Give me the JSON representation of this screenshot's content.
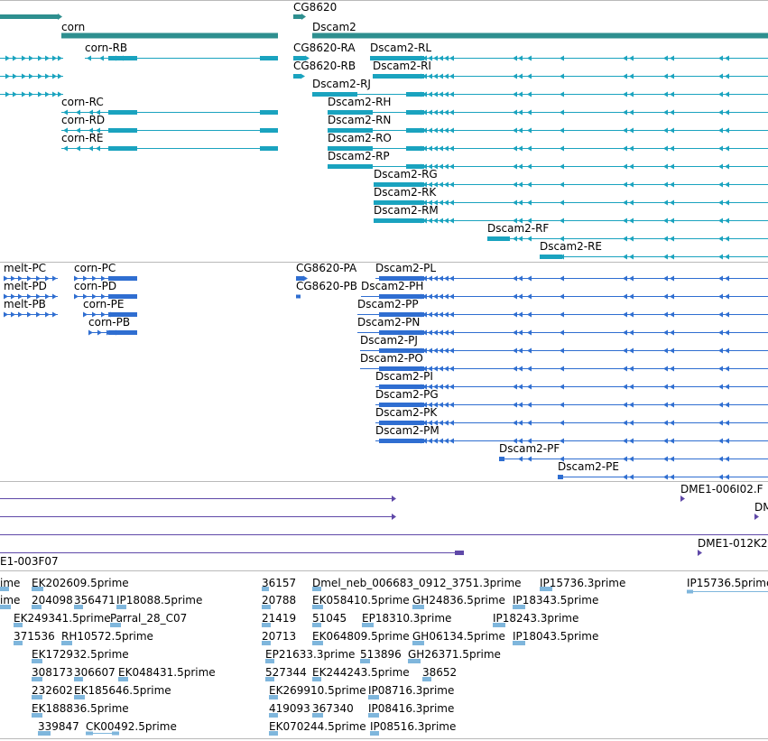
{
  "colors": {
    "gene": "#2e8f8f",
    "transcript": "#1aa3bf",
    "protein": "#2f6ed1",
    "clone": "#5f48a8",
    "est": "#7fb6dc",
    "separator": "#b9b9b9",
    "text": "#000000"
  },
  "icons": {
    "strand_plus": "arrow-right",
    "strand_minus": "chevron-left"
  },
  "tracks": {
    "genes": {
      "labels": {
        "corn": "corn",
        "cg8620": "CG8620",
        "dscam2": "Dscam2"
      }
    },
    "transcripts": {
      "labels": {
        "corn_rb": "corn-RB",
        "corn_rc": "corn-RC",
        "corn_rd": "corn-RD",
        "corn_re": "corn-RE",
        "cg8620_ra": "CG8620-RA",
        "cg8620_rb": "CG8620-RB",
        "dscam2_rl": "Dscam2-RL",
        "dscam2_ri": "Dscam2-RI",
        "dscam2_rj": "Dscam2-RJ",
        "dscam2_rh": "Dscam2-RH",
        "dscam2_rn": "Dscam2-RN",
        "dscam2_ro": "Dscam2-RO",
        "dscam2_rp": "Dscam2-RP",
        "dscam2_rg": "Dscam2-RG",
        "dscam2_rk": "Dscam2-RK",
        "dscam2_rm": "Dscam2-RM",
        "dscam2_rf": "Dscam2-RF",
        "dscam2_re": "Dscam2-RE"
      }
    },
    "proteins": {
      "labels": {
        "melt_pc": "melt-PC",
        "melt_pd": "melt-PD",
        "melt_pb": "melt-PB",
        "corn_pc": "corn-PC",
        "corn_pd": "corn-PD",
        "corn_pe": "corn-PE",
        "corn_pb": "corn-PB",
        "cg8620_pa": "CG8620-PA",
        "cg8620_pb": "CG8620-PB",
        "dscam2_pl": "Dscam2-PL",
        "dscam2_ph": "Dscam2-PH",
        "dscam2_pp": "Dscam2-PP",
        "dscam2_pn": "Dscam2-PN",
        "dscam2_pj": "Dscam2-PJ",
        "dscam2_po": "Dscam2-PO",
        "dscam2_pi": "Dscam2-PI",
        "dscam2_pg": "Dscam2-PG",
        "dscam2_pk": "Dscam2-PK",
        "dscam2_pm": "Dscam2-PM",
        "dscam2_pf": "Dscam2-PF",
        "dscam2_pe": "Dscam2-PE"
      }
    },
    "clones": {
      "labels": {
        "dme1_006i02": "DME1-006I02.F",
        "dm_partial": "DM",
        "dme1_003f07": "E1-003F07",
        "dme1_012k": "DME1-012K2"
      }
    },
    "ests": {
      "labels": [
        "ime",
        "EK202609.5prime",
        "36157",
        "Dmel_neb_006683_0912_3751.3prime",
        "IP15736.3prime",
        "IP15736.5prime",
        "ime",
        "204098",
        "356471",
        "IP18088.5prime",
        "20788",
        "EK058410.5prime",
        "GH24836.5prime",
        "IP18343.5prime",
        "EK249341.5prime",
        "Parral_28_C07",
        "21419",
        "51045",
        "EP18310.3prime",
        "IP18243.3prime",
        "371536",
        "RH10572.5prime",
        "20713",
        "EK064809.5prime",
        "GH06134.5prime",
        "IP18043.5prime",
        "EK172932.5prime",
        "EP21633.3prime",
        "513896",
        "GH26371.5prime",
        "308173",
        "306607",
        "EK048431.5prime",
        "527344",
        "EK244243.5prime",
        "38652",
        "232602",
        "EK185646.5prime",
        "EK269910.5prime",
        "IP08716.3prime",
        "EK188836.5prime",
        "419093",
        "367340",
        "IP08416.3prime",
        "339847",
        "CK00492.5prime",
        "EK070244.5prime",
        "IP08516.3prime"
      ]
    }
  }
}
